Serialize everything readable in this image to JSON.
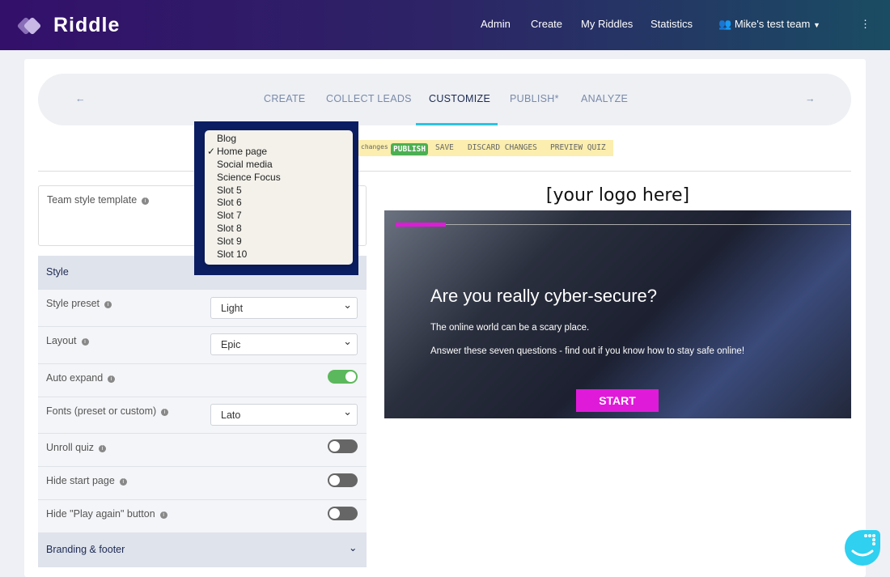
{
  "header": {
    "brand": "Riddle",
    "nav": [
      "Admin",
      "Create",
      "My Riddles",
      "Statistics"
    ],
    "team": "Mike's test team"
  },
  "steps": {
    "items": [
      "CREATE",
      "COLLECT LEADS",
      "CUSTOMIZE",
      "PUBLISH*",
      "ANALYZE"
    ],
    "active": "CUSTOMIZE"
  },
  "savebar": {
    "changes": "changes",
    "publish": "PUBLISH",
    "save": "SAVE",
    "discard": "DISCARD CHANGES",
    "preview": "PREVIEW QUIZ"
  },
  "template": {
    "label": "Team style template"
  },
  "dropdown": {
    "options": [
      "Blog",
      "Home page",
      "Social media",
      "Science Focus",
      "Slot 5",
      "Slot 6",
      "Slot 7",
      "Slot 8",
      "Slot 9",
      "Slot 10"
    ],
    "selected": "Home page",
    "check": "✓"
  },
  "style": {
    "title": "Style",
    "preset_label": "Style preset",
    "preset": "Light",
    "layout_label": "Layout",
    "layout": "Epic",
    "auto_expand": "Auto expand",
    "auto_expand_on": true,
    "fonts_label": "Fonts (preset or custom)",
    "fonts": "Lato",
    "unroll": "Unroll quiz",
    "unroll_on": false,
    "hide_start": "Hide start page",
    "hide_start_on": false,
    "hide_play": "Hide \"Play again\" button",
    "hide_play_on": false
  },
  "branding": {
    "title": "Branding & footer"
  },
  "preview": {
    "logo": "[your logo here]",
    "title": "Are you really cyber-secure?",
    "line1": "The online world can be a scary place.",
    "line2": "Answer these seven questions - find out if you know how to stay safe online!",
    "start": "START"
  },
  "colors": {
    "accent": "#e01ad9",
    "tab_underline": "#2bc3e3",
    "toggle_on": "#5cb85c"
  }
}
